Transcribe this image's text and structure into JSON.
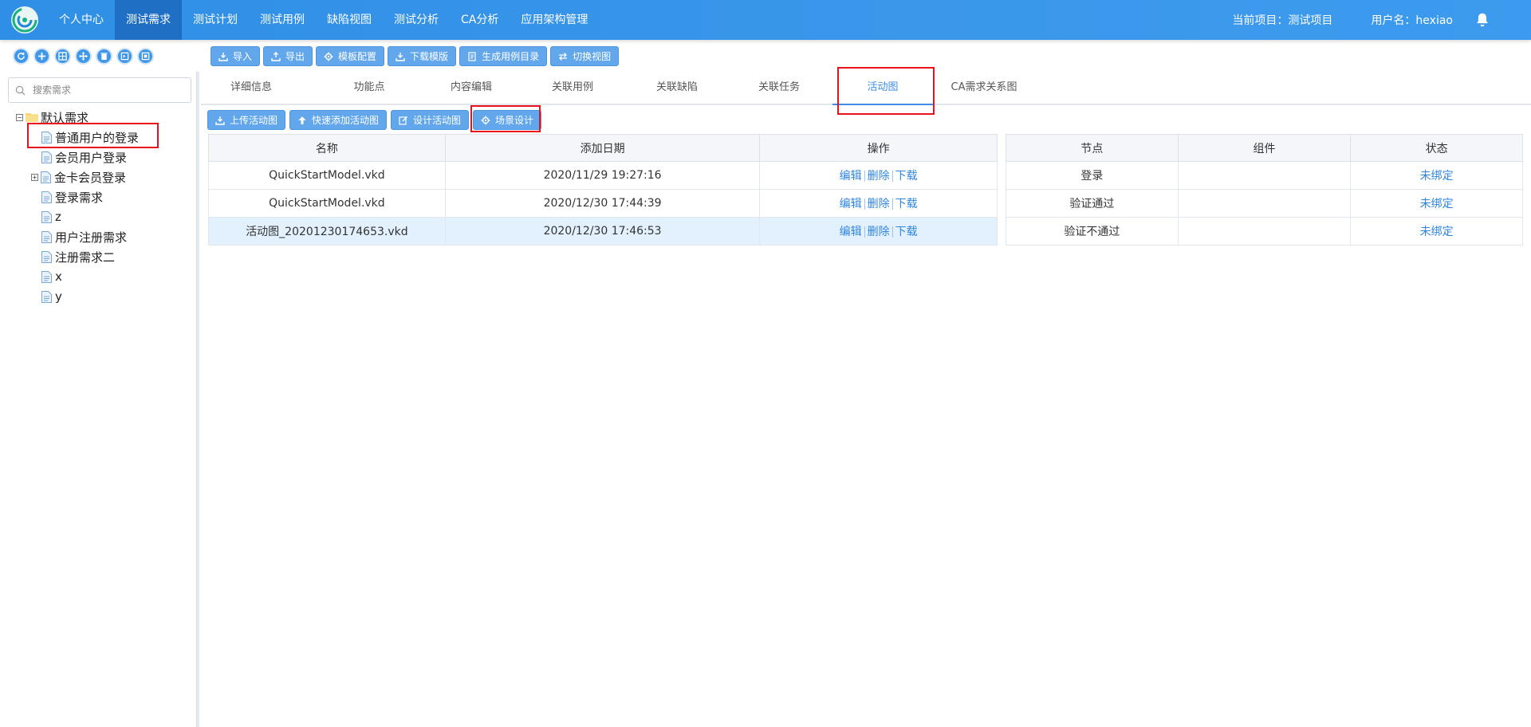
{
  "topbar": {
    "nav": [
      "个人中心",
      "测试需求",
      "测试计划",
      "测试用例",
      "缺陷视图",
      "测试分析",
      "CA分析",
      "应用架构管理"
    ],
    "active_index": 1,
    "current_project": "当前项目：测试项目",
    "username": "用户名：hexiao"
  },
  "toolbar": {
    "tree_tools": [
      "refresh-icon",
      "add-icon",
      "grid-icon",
      "move-icon",
      "trash-icon",
      "export-icon",
      "save-icon"
    ],
    "buttons": [
      "导入",
      "导出",
      "模板配置",
      "下载模版",
      "生成用例目录",
      "切换视图"
    ]
  },
  "sidebar": {
    "search_placeholder": "搜索需求",
    "tree": [
      {
        "label": "默认需求",
        "type": "folder",
        "expanded": true
      },
      {
        "label": "普通用户的登录",
        "type": "file"
      },
      {
        "label": "会员用户登录",
        "type": "file"
      },
      {
        "label": "金卡会员登录",
        "type": "file",
        "collapsed": true
      },
      {
        "label": "登录需求",
        "type": "file"
      },
      {
        "label": "z",
        "type": "file"
      },
      {
        "label": "用户注册需求",
        "type": "file"
      },
      {
        "label": "注册需求二",
        "type": "file"
      },
      {
        "label": "x",
        "type": "file"
      },
      {
        "label": "y",
        "type": "file"
      }
    ]
  },
  "tabs": {
    "items": [
      "详细信息",
      "功能点",
      "内容编辑",
      "关联用例",
      "关联缺陷",
      "关联任务",
      "活动图",
      "CA需求关系图"
    ],
    "active_index": 6
  },
  "subtools": [
    "上传活动图",
    "快速添加活动图",
    "设计活动图",
    "场景设计"
  ],
  "files_table": {
    "headers": [
      "名称",
      "添加日期",
      "操作"
    ],
    "rows": [
      {
        "name": "QuickStartModel.vkd",
        "date": "2020/11/29 19:27:16"
      },
      {
        "name": "QuickStartModel.vkd",
        "date": "2020/12/30 17:44:39"
      },
      {
        "name": "活动图_20201230174653.vkd",
        "date": "2020/12/30 17:46:53"
      }
    ],
    "selected_index": 2,
    "ops": [
      "编辑",
      "删除",
      "下载"
    ]
  },
  "nodes_table": {
    "headers": [
      "节点",
      "组件",
      "状态"
    ],
    "rows": [
      {
        "node": "登录",
        "component": "",
        "status": "未绑定"
      },
      {
        "node": "验证通过",
        "component": "",
        "status": "未绑定"
      },
      {
        "node": "验证不通过",
        "component": "",
        "status": "未绑定"
      }
    ]
  },
  "colors": {
    "accent": "#3d8ee6",
    "nav_active": "#1f6fc5",
    "highlight": "#e8121d"
  }
}
